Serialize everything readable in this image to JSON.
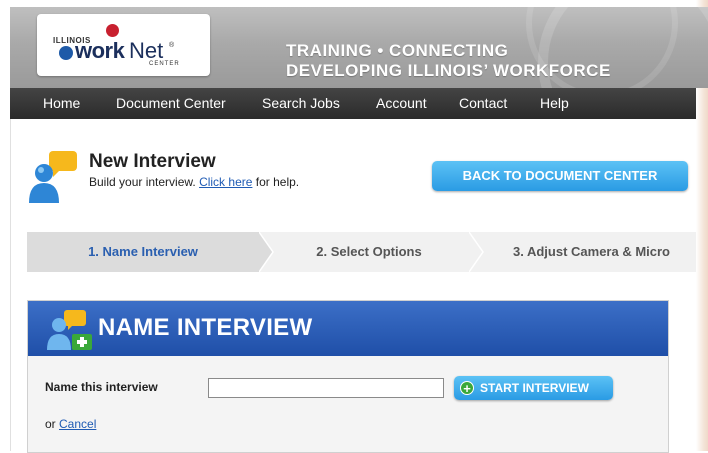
{
  "header": {
    "logo": {
      "state": "ILLINOIS",
      "work": "work",
      "net": "Net",
      "center": "CENTER",
      "reg": "®"
    },
    "tagline_line1": "TRAINING • CONNECTING",
    "tagline_line2": "DEVELOPING ILLINOIS’ WORKFORCE"
  },
  "nav": {
    "items": [
      "Home",
      "Document Center",
      "Search Jobs",
      "Account",
      "Contact",
      "Help"
    ]
  },
  "page": {
    "title": "New Interview",
    "subtitle_prefix": "Build your interview.",
    "help_link": "Click here",
    "subtitle_suffix": "for help.",
    "back_button": "BACK TO DOCUMENT CENTER"
  },
  "steps": [
    "1. Name Interview",
    "2. Select Options",
    "3. Adjust Camera & Micro"
  ],
  "panel": {
    "title": "NAME INTERVIEW",
    "field_label": "Name this interview",
    "field_value": "",
    "start_button": "START INTERVIEW",
    "or_text": "or",
    "cancel_link": "Cancel"
  },
  "colors": {
    "accent_blue": "#2a9be4",
    "panel_blue": "#1f4fa8",
    "nav_dark": "#2b2b2b",
    "link_blue": "#1f5bb4"
  }
}
